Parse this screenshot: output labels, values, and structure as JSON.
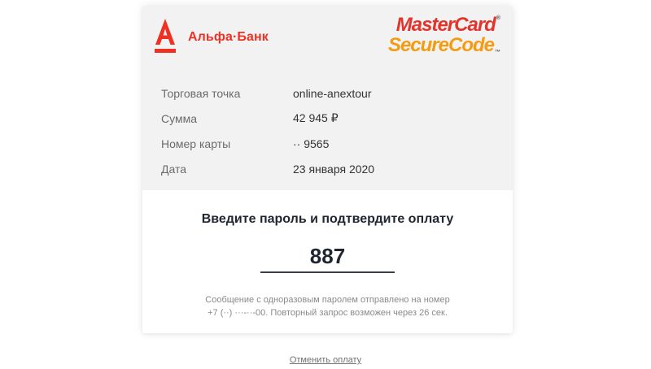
{
  "bank": {
    "name": "Альфа·Банк",
    "brand_color": "#ef3124"
  },
  "secure_logo": {
    "line1": "MasterCard",
    "line2": "SecureCode",
    "reg_mark": "®",
    "tm_mark": "™",
    "colors": {
      "line1": "#e2342b",
      "line2": "#f39c12"
    }
  },
  "transaction": {
    "rows": [
      {
        "label": "Торговая точка",
        "value": "online-anextour"
      },
      {
        "label": "Сумма",
        "value": "42 945 ₽"
      },
      {
        "label": "Номер карты",
        "value": "·· 9565"
      },
      {
        "label": "Дата",
        "value": "23 января 2020"
      }
    ]
  },
  "confirm": {
    "prompt": "Введите пароль и подтвердите оплату",
    "code_value": "887",
    "notice_line1": "Сообщение с одноразовым паролем отправлено на номер",
    "notice_line2": "+7 (··) ···-··-00. Повторный запрос возможен через 26 сек."
  },
  "cancel": {
    "label": "Отменить оплату"
  }
}
